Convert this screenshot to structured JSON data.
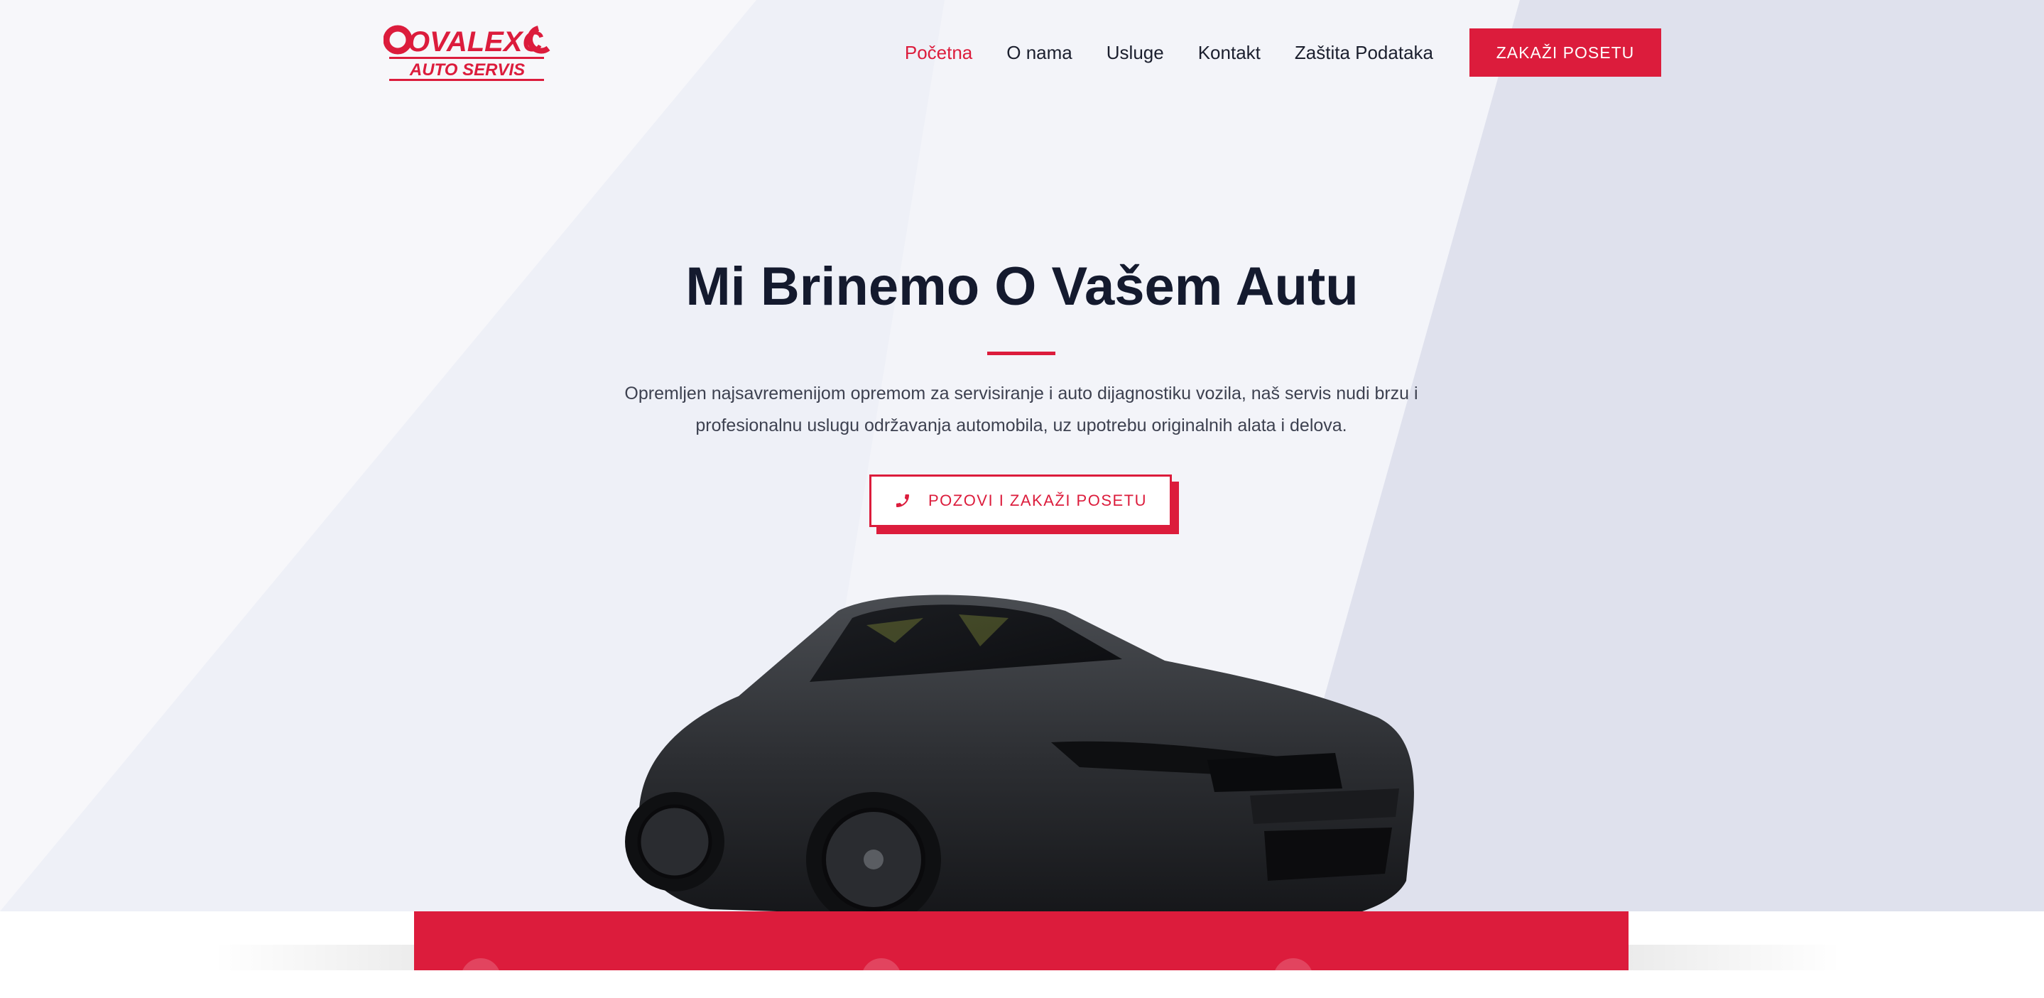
{
  "brand": {
    "logo_top": "OVALEXC",
    "logo_bottom": "AUTO SERVIS",
    "accent_color": "#dc1c3c",
    "dark_color": "#141a2e"
  },
  "nav": {
    "items": [
      {
        "label": "Početna",
        "active": true
      },
      {
        "label": "O nama",
        "active": false
      },
      {
        "label": "Usluge",
        "active": false
      },
      {
        "label": "Kontakt",
        "active": false
      },
      {
        "label": "Zaštita Podataka",
        "active": false
      }
    ],
    "cta_label": "ZAKAŽI POSETU"
  },
  "hero": {
    "title": "Mi Brinemo O Vašem Autu",
    "description": "Opremljen najsavremenijom opremom za servisiranje i auto dijagnostiku vozila, naš servis nudi brzu i profesionalnu uslugu održavanja automobila, uz upotrebu originalnih alata i delova.",
    "cta_label": "POZOVI I ZAKAŽI POSETU",
    "cta_icon": "phone-icon",
    "image": "black-sports-car"
  }
}
